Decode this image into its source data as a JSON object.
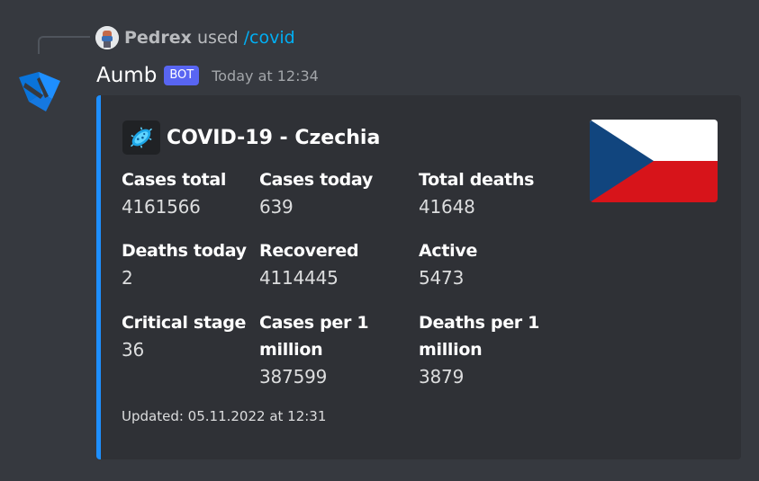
{
  "reply": {
    "username": "Pedrex",
    "used_text": "used",
    "command": "/covid"
  },
  "message": {
    "author": "Aumb",
    "bot_tag": "BOT",
    "timestamp": "Today at 12:34"
  },
  "embed": {
    "accent_color": "#1e8fff",
    "icon": "virus-icon",
    "title": "COVID-19 - Czechia",
    "thumbnail": "czech-flag",
    "fields": [
      {
        "name": "Cases total",
        "value": "4161566"
      },
      {
        "name": "Cases today",
        "value": "639"
      },
      {
        "name": "Total deaths",
        "value": "41648"
      },
      {
        "name": "Deaths today",
        "value": "2"
      },
      {
        "name": "Recovered",
        "value": "4114445"
      },
      {
        "name": "Active",
        "value": "5473"
      },
      {
        "name": "Critical stage",
        "value": "36"
      },
      {
        "name": "Cases per 1 million",
        "value": "387599"
      },
      {
        "name": "Deaths per 1 million",
        "value": "3879"
      }
    ],
    "footer": "Updated: 05.11.2022 at 12:31"
  },
  "colors": {
    "background": "#36393f",
    "embed_background": "#2f3136",
    "link": "#00aff4",
    "bot_tag": "#5865f2",
    "flag_blue": "#11457e",
    "flag_red": "#d7141a"
  }
}
